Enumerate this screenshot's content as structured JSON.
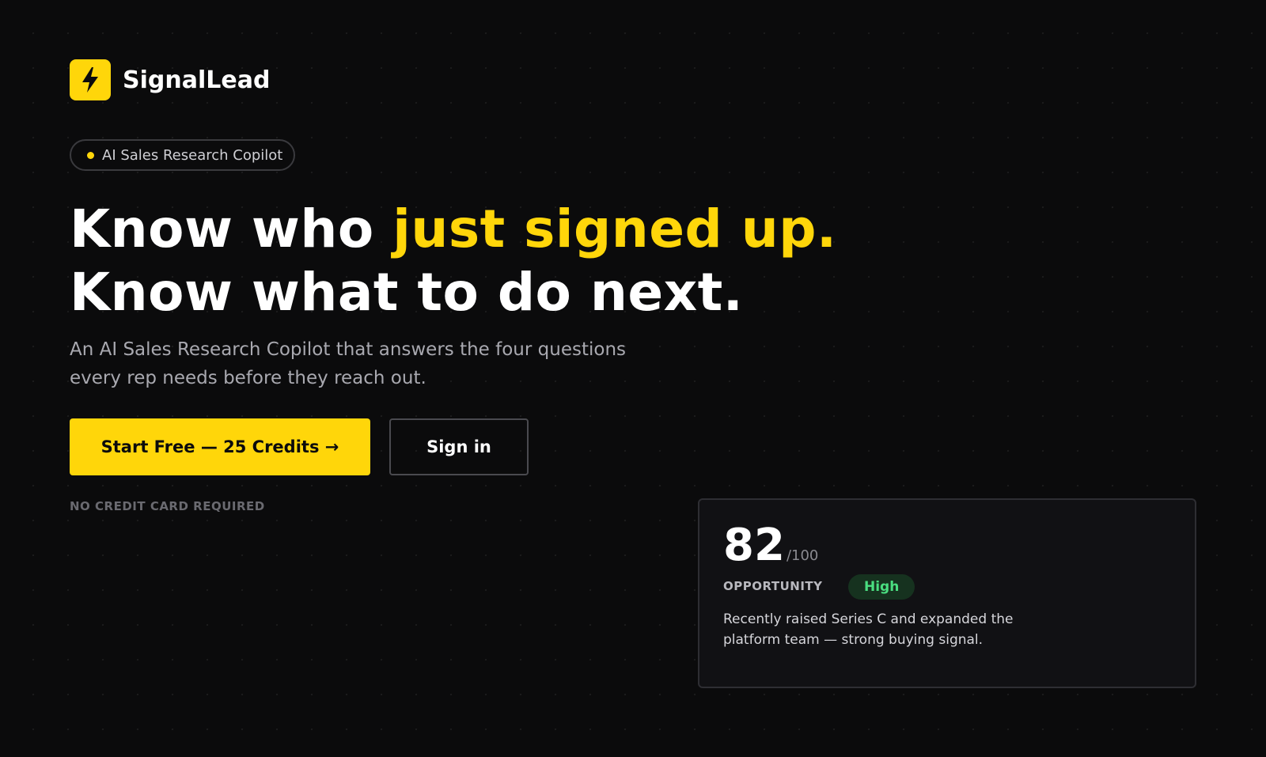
{
  "brand": {
    "name": "SignalLead",
    "logo_icon": "lightning-bolt-icon",
    "logo_color": "#ffd60a"
  },
  "badge_pill": {
    "text": "AI Sales Research Copilot"
  },
  "hero": {
    "line1_prefix": "Know who ",
    "line1_accent": "just signed up.",
    "line2": "Know what to do next.",
    "subtext": "An AI Sales Research Copilot that answers the four questions every rep needs before they reach out."
  },
  "cta": {
    "primary_label": "Start Free — 25 Credits →",
    "secondary_label": "Sign in",
    "fineprint": "NO CREDIT CARD REQUIRED"
  },
  "score_card": {
    "score": "82",
    "score_max": "/100",
    "label": "OPPORTUNITY",
    "level": "High",
    "description": "Recently raised Series C and expanded the platform team — strong buying signal."
  },
  "colors": {
    "accent": "#ffd60a",
    "background": "#0b0b0c",
    "success": "#4ade80"
  }
}
